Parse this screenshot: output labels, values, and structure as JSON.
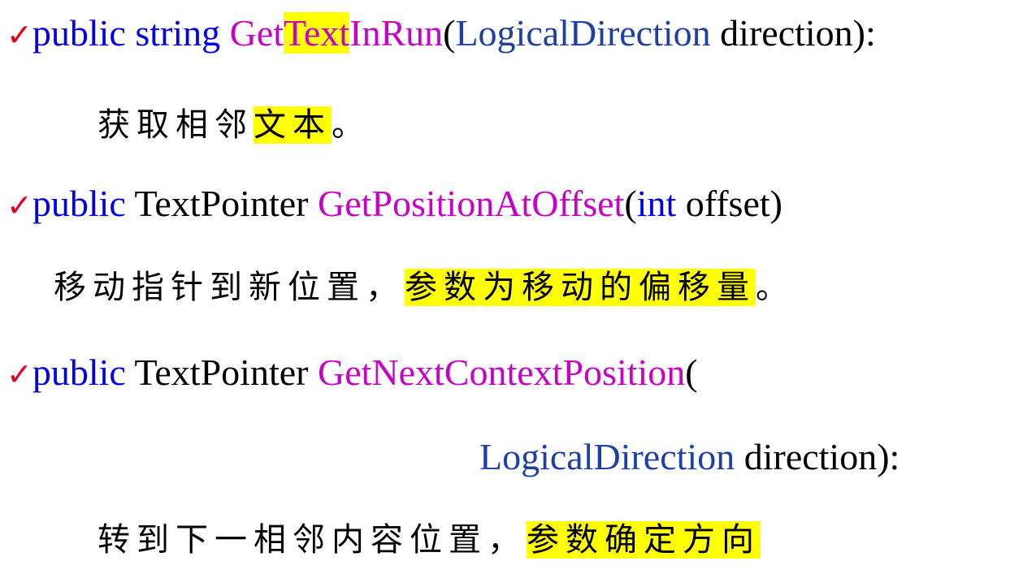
{
  "bullet": "✓",
  "item1": {
    "keyword": "public",
    "return_type": "string",
    "method_prefix": "Get",
    "method_highlight": "Text",
    "method_suffix": "InRun",
    "open_paren": "(",
    "param_type": "LogicalDirection",
    "param_name": " direction):",
    "desc_prefix": "获取相邻",
    "desc_highlight": "文本",
    "desc_suffix": "。"
  },
  "item2": {
    "keyword": "public",
    "return_type": " TextPointer ",
    "method": "GetPositionAtOffset",
    "open_paren": "(",
    "param_type": "int",
    "param_name": " offset)",
    "desc_prefix": "移动指针到新位置，",
    "desc_highlight": "参数为移动的偏移量",
    "desc_suffix": "。"
  },
  "item3": {
    "keyword": "public",
    "return_type": " TextPointer ",
    "method": "GetNextContextPosition",
    "open_paren": "(",
    "param_type": "LogicalDirection",
    "param_name": " direction):",
    "desc_prefix": "转到下一相邻内容位置，",
    "desc_highlight": "参数确定方向"
  },
  "colors": {
    "bullet": "#e0001c",
    "keyword": "#0000ee",
    "method": "#c800c8",
    "type": "#1f3fa8",
    "highlight": "#ffff00"
  }
}
